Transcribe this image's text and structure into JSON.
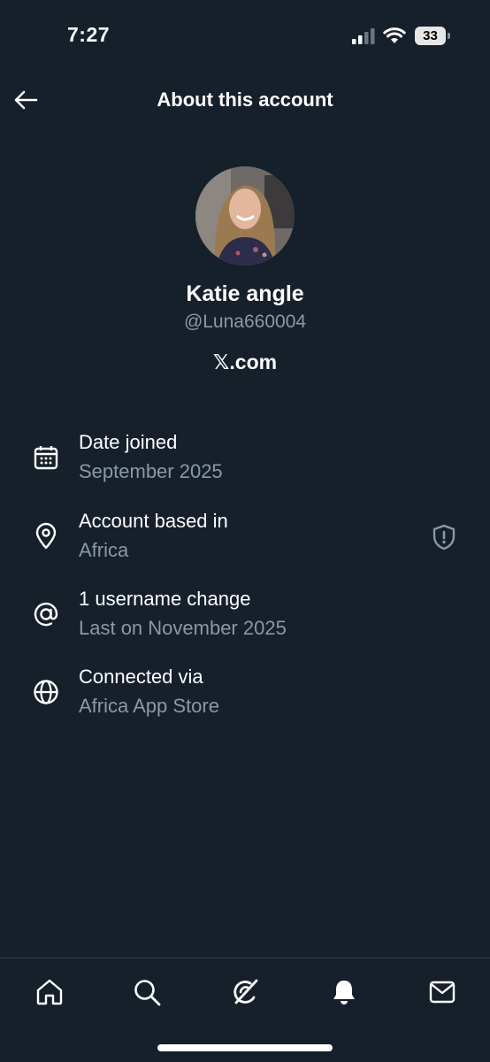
{
  "status_bar": {
    "time": "7:27",
    "battery": "33"
  },
  "header": {
    "title": "About this account",
    "back_icon": "arrow-left-icon"
  },
  "profile": {
    "name": "Katie angle",
    "handle": "@Luna660004",
    "site": "𝕏.com"
  },
  "info": [
    {
      "icon": "calendar-icon",
      "title": "Date joined",
      "subtitle": "September 2025"
    },
    {
      "icon": "location-pin-icon",
      "title": "Account based in",
      "subtitle": "Africa",
      "badge_icon": "shield-icon"
    },
    {
      "icon": "at-sign-icon",
      "title": "1 username change",
      "subtitle": "Last on November 2025"
    },
    {
      "icon": "globe-icon",
      "title": "Connected via",
      "subtitle": "Africa App Store"
    }
  ],
  "nav": [
    {
      "icon": "home-icon"
    },
    {
      "icon": "search-icon"
    },
    {
      "icon": "grok-icon"
    },
    {
      "icon": "notifications-bell-icon"
    },
    {
      "icon": "messages-envelope-icon"
    }
  ],
  "colors": {
    "background": "#15202b",
    "primary_text": "#ffffff",
    "secondary_text": "#8b98a5",
    "divider": "#2f3b47"
  }
}
